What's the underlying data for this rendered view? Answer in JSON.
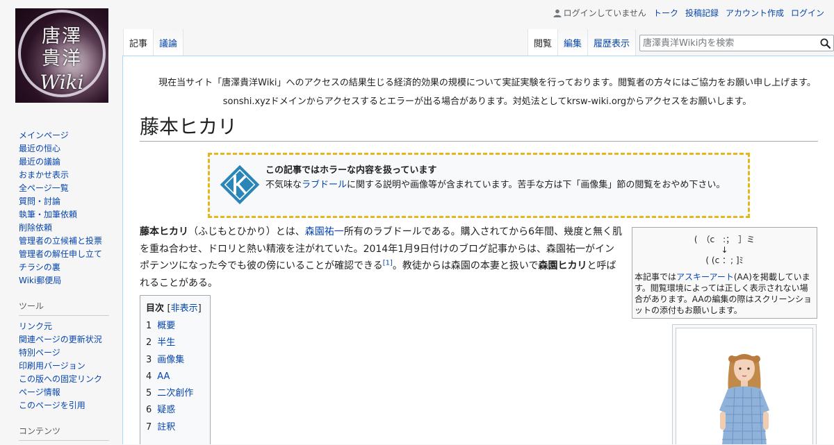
{
  "logo": {
    "line1": "唐澤",
    "line2": "貴洋",
    "line3": "Wiki"
  },
  "personal": {
    "anon": "ログインしていません",
    "talk": "トーク",
    "contributions": "投稿記録",
    "create_account": "アカウント作成",
    "login": "ログイン"
  },
  "tabs_left": [
    {
      "label": "記事",
      "selected": true
    },
    {
      "label": "議論",
      "selected": false
    }
  ],
  "tabs_right": [
    {
      "label": "閲覧",
      "selected": true
    },
    {
      "label": "編集",
      "selected": false
    },
    {
      "label": "履歴表示",
      "selected": false
    }
  ],
  "search": {
    "placeholder": "唐澤貴洋Wiki内を検索"
  },
  "sidebar": {
    "main": [
      "メインページ",
      "最近の恒心",
      "最近の議論",
      "おまかせ表示",
      "全ページ一覧",
      "質問・討論",
      "執筆・加筆依頼",
      "削除依頼",
      "管理者の立候補と投票",
      "管理者の解任申し立て",
      "チラシの裏",
      "Wiki郵便局"
    ],
    "tools_heading": "ツール",
    "tools": [
      "リンク元",
      "関連ページの更新状況",
      "特別ページ",
      "印刷用バージョン",
      "この版への固定リンク",
      "ページ情報",
      "このページを引用"
    ],
    "contents_heading": "コンテンツ"
  },
  "notices": [
    "現在当サイト「唐澤貴洋Wiki」へのアクセスの結果生じる経済的効果の規模について実証実験を行っております。閲覧者の方々にはご協力をお願い申し上げます。",
    "sonshi.xyzドメインからアクセスするとエラーが出る場合があります。対処法としてkrsw-wiki.orgからアクセスをお願いします。"
  ],
  "title": "藤本ヒカリ",
  "ambox": {
    "title": "この記事ではホラーな内容を扱っています",
    "pre": "不気味な",
    "link": "ラブドール",
    "post": "に関する説明や画像等が含まれています。苦手な方は下「画像集」節の閲覧をおやめ下さい。"
  },
  "lead": {
    "name": "藤本ヒカリ",
    "t1": "（ふじもとひかり）とは、",
    "link": "森園祐一",
    "t2": "所有のラブドールである。購入されてから6年間、幾度と無く肌を重ね合わせ、ドロリと熱い精液を注がれていた。2014年1月9日付けのブログ記事からは、森園祐一がインポテンツになった今でも彼の傍にいることが確認できる",
    "ref": "[1]",
    "t3": "。教徒からは森園の本妻と扱いで",
    "name2": "森園ヒカリ",
    "t4": "と呼ばれることがある。"
  },
  "aa_box": {
    "aa_line1": "(　（c　:；　］ミ",
    "aa_line2": "↓",
    "aa_line3": "( (c ：; ]ﾐ",
    "pre": "本記事では",
    "link": "アスキーアート",
    "post": "(AA)を掲載しています。閲覧環境によっては正しく表示されない場合があります。AAの編集の際はスクリーンショットの添付もお願いします。"
  },
  "toc": {
    "title": "目次",
    "toggle_open": "[",
    "toggle": "非表示",
    "toggle_close": "]",
    "items": [
      {
        "num": "1",
        "label": "概要"
      },
      {
        "num": "2",
        "label": "半生"
      },
      {
        "num": "3",
        "label": "画像集"
      },
      {
        "num": "4",
        "label": "AA"
      },
      {
        "num": "5",
        "label": "二次創作"
      },
      {
        "num": "6",
        "label": "疑惑"
      },
      {
        "num": "7",
        "label": "註釈"
      }
    ]
  }
}
